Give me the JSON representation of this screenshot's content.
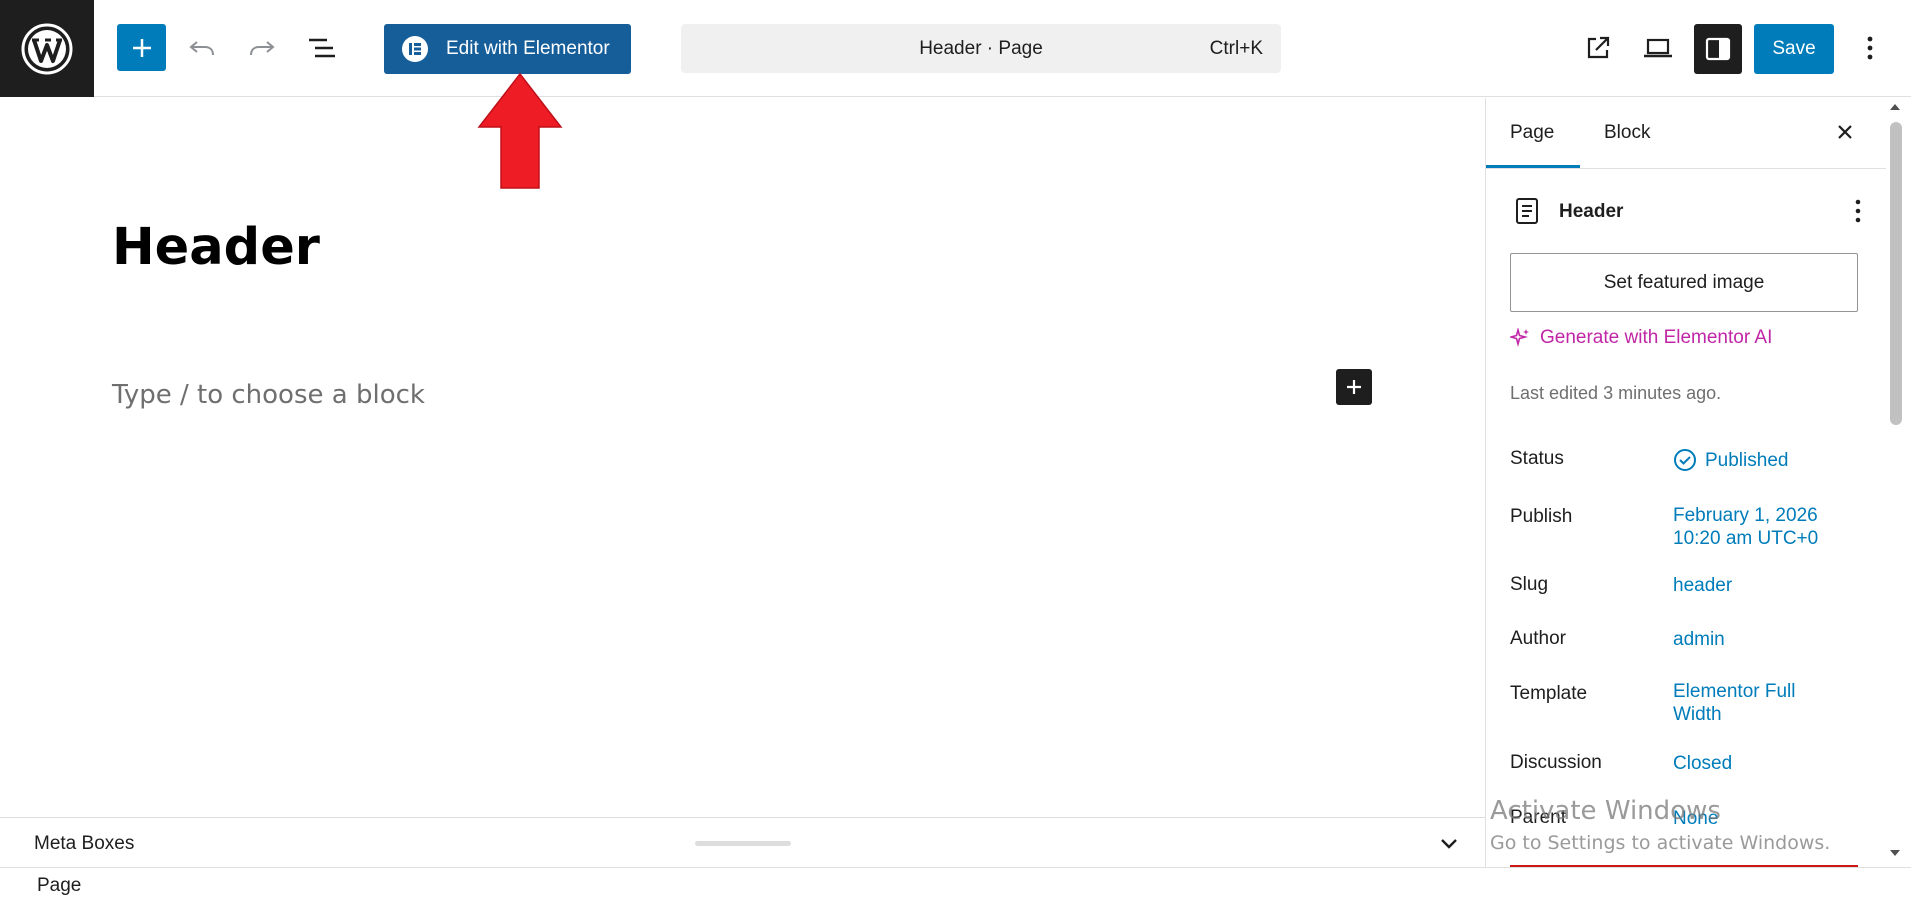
{
  "toolbar": {
    "elementor_button_label": "Edit with Elementor",
    "command_title": "Header · Page",
    "command_shortcut": "Ctrl+K",
    "save_label": "Save"
  },
  "canvas": {
    "page_title": "Header",
    "block_placeholder": "Type / to choose a block"
  },
  "meta_boxes": {
    "label": "Meta Boxes"
  },
  "footer": {
    "breadcrumb": "Page"
  },
  "sidebar": {
    "tabs": [
      {
        "label": "Page",
        "active": true
      },
      {
        "label": "Block",
        "active": false
      }
    ],
    "document_title": "Header",
    "featured_image_label": "Set featured image",
    "generate_ai_label": "Generate with Elementor AI",
    "last_edited": "Last edited 3 minutes ago.",
    "fields": {
      "status": {
        "label": "Status",
        "value": "Published"
      },
      "publish": {
        "label": "Publish",
        "value_line1": "February 1, 2026",
        "value_line2": "10:20 am UTC+0"
      },
      "slug": {
        "label": "Slug",
        "value": "header"
      },
      "author": {
        "label": "Author",
        "value": "admin"
      },
      "template": {
        "label": "Template",
        "value_line1": "Elementor Full",
        "value_line2": "Width"
      },
      "discussion": {
        "label": "Discussion",
        "value": "Closed"
      },
      "parent": {
        "label": "Parent",
        "value": "None"
      }
    }
  },
  "watermark": {
    "title": "Activate Windows",
    "subtitle": "Go to Settings to activate Windows."
  },
  "colors": {
    "accent": "#007cba",
    "elementor": "#155e9a",
    "ai_magenta": "#c026a6",
    "annotation_arrow": "#ee1c25"
  }
}
